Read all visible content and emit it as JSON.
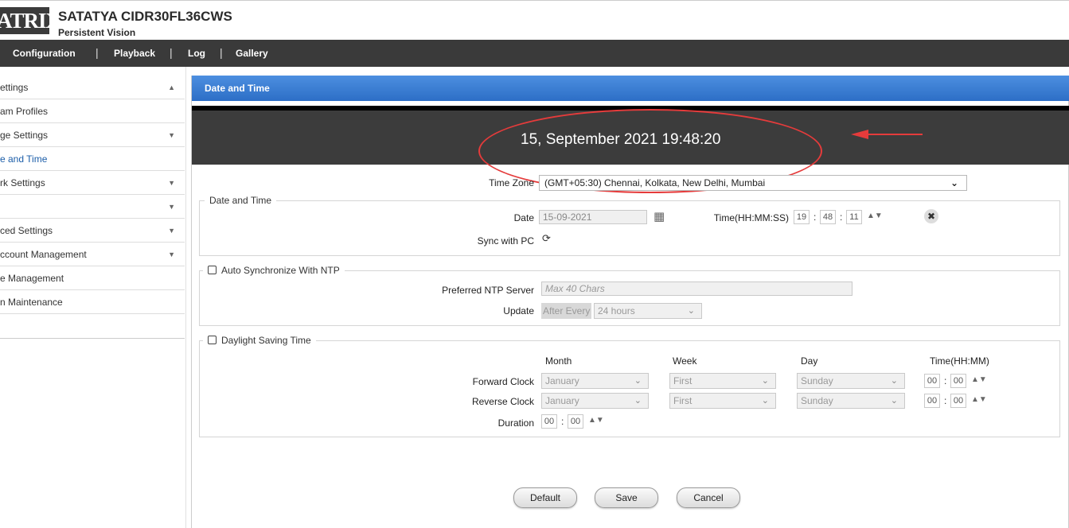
{
  "header": {
    "logo_text": "ATRIX",
    "model": "SATATYA CIDR30FL36CWS",
    "brand": "Persistent Vision"
  },
  "nav": {
    "items": [
      "Configuration",
      "Playback",
      "Log",
      "Gallery"
    ]
  },
  "sidebar": {
    "items": [
      {
        "label": "ettings",
        "arrow": "▲"
      },
      {
        "label": "am Profiles",
        "arrow": ""
      },
      {
        "label": "ge Settings",
        "arrow": "▼"
      },
      {
        "label": "e and Time",
        "arrow": ""
      },
      {
        "label": "rk Settings",
        "arrow": "▼"
      },
      {
        "label": "",
        "arrow": "▼"
      },
      {
        "label": "ced Settings",
        "arrow": "▼"
      },
      {
        "label": "ccount Management",
        "arrow": "▼"
      },
      {
        "label": "e Management",
        "arrow": ""
      },
      {
        "label": "n Maintenance",
        "arrow": ""
      }
    ]
  },
  "panel": {
    "title": "Date and Time",
    "clock": "15, September 2021   19:48:20"
  },
  "timezone": {
    "label": "Time Zone",
    "value": "(GMT+05:30) Chennai, Kolkata, New Delhi, Mumbai"
  },
  "date_time_group": {
    "legend": "Date and Time",
    "date_label": "Date",
    "date_value": "15-09-2021",
    "time_label": "Time(HH:MM:SS)",
    "hh": "19",
    "mm": "48",
    "ss": "11",
    "sync_label": "Sync with PC"
  },
  "ntp_group": {
    "legend": "Auto Synchronize With NTP",
    "server_label": "Preferred NTP Server",
    "server_placeholder": "Max 40 Chars",
    "update_label": "Update",
    "update_prefix": "After Every",
    "update_value": "24 hours"
  },
  "dst_group": {
    "legend": "Daylight Saving Time",
    "headers": {
      "month": "Month",
      "week": "Week",
      "day": "Day",
      "time": "Time(HH:MM)"
    },
    "forward_label": "Forward Clock",
    "reverse_label": "Reverse Clock",
    "duration_label": "Duration",
    "forward": {
      "month": "January",
      "week": "First",
      "day": "Sunday",
      "hh": "00",
      "mm": "00"
    },
    "reverse": {
      "month": "January",
      "week": "First",
      "day": "Sunday",
      "hh": "00",
      "mm": "00"
    },
    "duration": {
      "hh": "00",
      "mm": "00"
    }
  },
  "buttons": {
    "default": "Default",
    "save": "Save",
    "cancel": "Cancel"
  },
  "colors": {
    "nav_bg": "#3a3a3a",
    "title_bar": "#3d7fd6",
    "annotation_red": "#e53b3b"
  }
}
